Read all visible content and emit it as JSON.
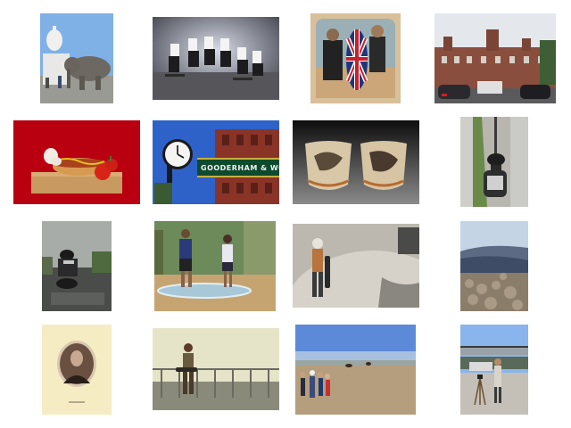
{
  "gallery": {
    "thumbnails": [
      {
        "subject": "elephant in front of capitol dome"
      },
      {
        "subject": "group of skateboarders jumping"
      },
      {
        "subject": "couple with union jack surfboard on beach"
      },
      {
        "subject": "historic brick building with traffic"
      },
      {
        "subject": "hot dog on cutting board with tomatoes"
      },
      {
        "subject": "street clock and gooderham and worts sign",
        "sign_text": "GOODERHAM & WORTS"
      },
      {
        "subject": "two painted ceramic cups"
      },
      {
        "subject": "portable toilet seat on pole by sidewalk"
      },
      {
        "subject": "motorcyclist on wet street"
      },
      {
        "subject": "people balancing on surfboards on sand"
      },
      {
        "subject": "skateboarder in concrete bowl"
      },
      {
        "subject": "mountain vista with rocky slope"
      },
      {
        "subject": "vintage oval portrait of man"
      },
      {
        "subject": "skateboarder on rail by water"
      },
      {
        "subject": "people watching horse race on beach"
      },
      {
        "subject": "photographer with tripod near train bridge"
      }
    ]
  }
}
